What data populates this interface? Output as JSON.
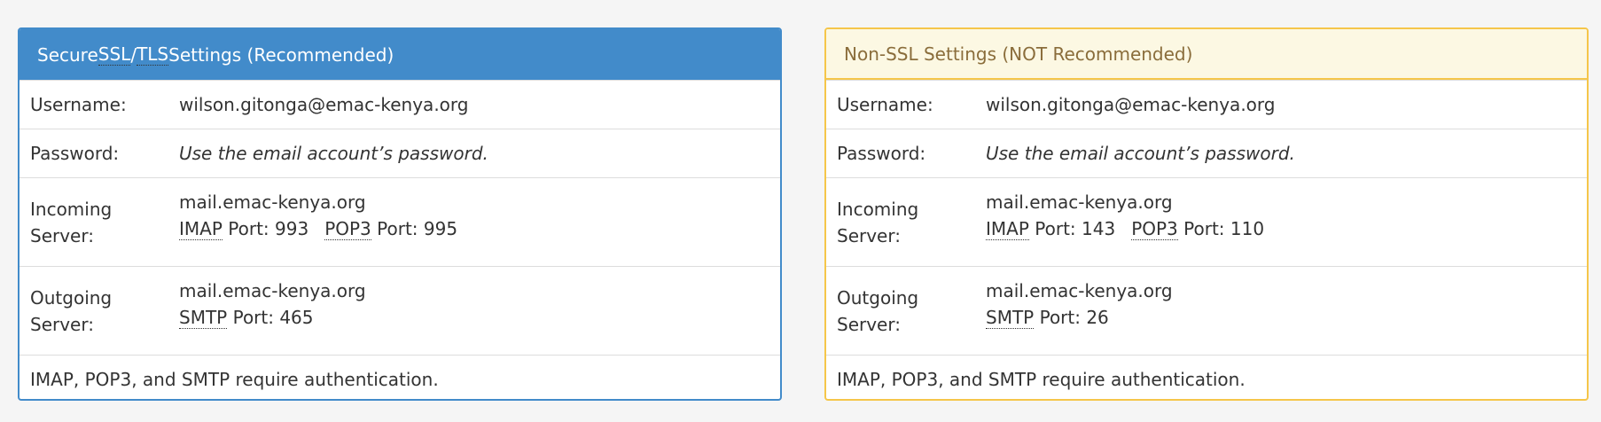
{
  "secure": {
    "heading_pre": "Secure ",
    "heading_abbr1": "SSL",
    "heading_slash": "/",
    "heading_abbr2": "TLS",
    "heading_post": " Settings (Recommended)",
    "username_label": "Username:",
    "username_value": "wilson.gitonga@emac-kenya.org",
    "password_label": "Password:",
    "password_value": "Use the email account’s password.",
    "incoming_label_1": "Incoming",
    "incoming_label_2": "Server:",
    "incoming_host": "mail.emac-kenya.org",
    "imap_abbr": "IMAP",
    "imap_port": " Port: 993",
    "pop3_abbr": "POP3",
    "pop3_port": " Port: 995",
    "outgoing_label_1": "Outgoing",
    "outgoing_label_2": "Server:",
    "outgoing_host": "mail.emac-kenya.org",
    "smtp_abbr": "SMTP",
    "smtp_port": " Port: 465",
    "note": "IMAP, POP3, and SMTP require authentication."
  },
  "insecure": {
    "heading": "Non-SSL Settings (NOT Recommended)",
    "username_label": "Username:",
    "username_value": "wilson.gitonga@emac-kenya.org",
    "password_label": "Password:",
    "password_value": "Use the email account’s password.",
    "incoming_label_1": "Incoming",
    "incoming_label_2": "Server:",
    "incoming_host": "mail.emac-kenya.org",
    "imap_abbr": "IMAP",
    "imap_port": " Port: 143",
    "pop3_abbr": "POP3",
    "pop3_port": " Port: 110",
    "outgoing_label_1": "Outgoing",
    "outgoing_label_2": "Server:",
    "outgoing_host": "mail.emac-kenya.org",
    "smtp_abbr": "SMTP",
    "smtp_port": " Port: 26",
    "note": "IMAP, POP3, and SMTP require authentication."
  },
  "colors": {
    "secure_accent": "#428bca",
    "insecure_accent": "#f5c64a",
    "insecure_heading_bg": "#fcf8e3",
    "insecure_heading_text": "#8a6d3b"
  }
}
